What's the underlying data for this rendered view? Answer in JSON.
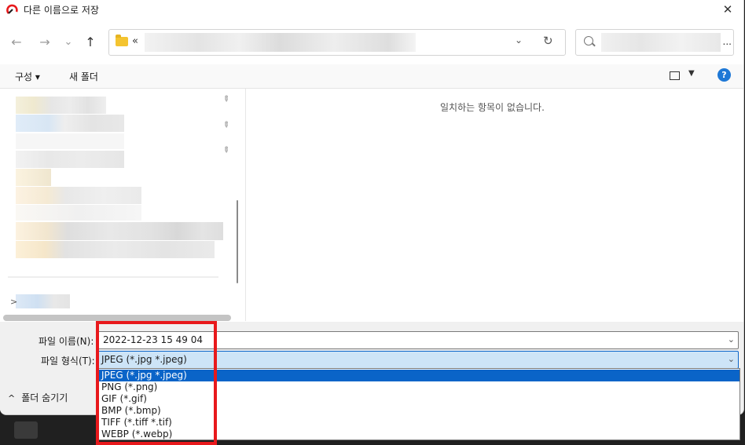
{
  "window": {
    "title": "다른 이름으로 저장",
    "close_glyph": "✕"
  },
  "address": {
    "back_glyph": "←",
    "forward_glyph": "→",
    "recent_glyph": "⌄",
    "up_glyph": "↑",
    "separator": "«",
    "dropdown_glyph": "⌄",
    "refresh_glyph": "↻",
    "search_more": "..."
  },
  "toolbar": {
    "organize_label": "구성 ▾",
    "new_folder_label": "새 폴더",
    "view_caret": "▼",
    "help_label": "?"
  },
  "content": {
    "empty_message": "일치하는 항목이 없습니다."
  },
  "form": {
    "filename_label": "파일 이름(N):",
    "filename_value": "2022-12-23 15 49 04",
    "filetype_label": "파일 형식(T):",
    "filetype_value": "JPEG (*.jpg *.jpeg)",
    "dropdown_glyph": "⌄",
    "filetype_options": [
      "JPEG (*.jpg *.jpeg)",
      "PNG (*.png)",
      "GIF (*.gif)",
      "BMP (*.bmp)",
      "TIFF (*.tiff *.tif)",
      "WEBP (*.webp)"
    ],
    "hide_folders_label": "폴더 숨기기",
    "hide_caret": "^"
  },
  "colors": {
    "accent": "#0a64c8",
    "highlight": "#e8191c",
    "help": "#1e78d6"
  }
}
